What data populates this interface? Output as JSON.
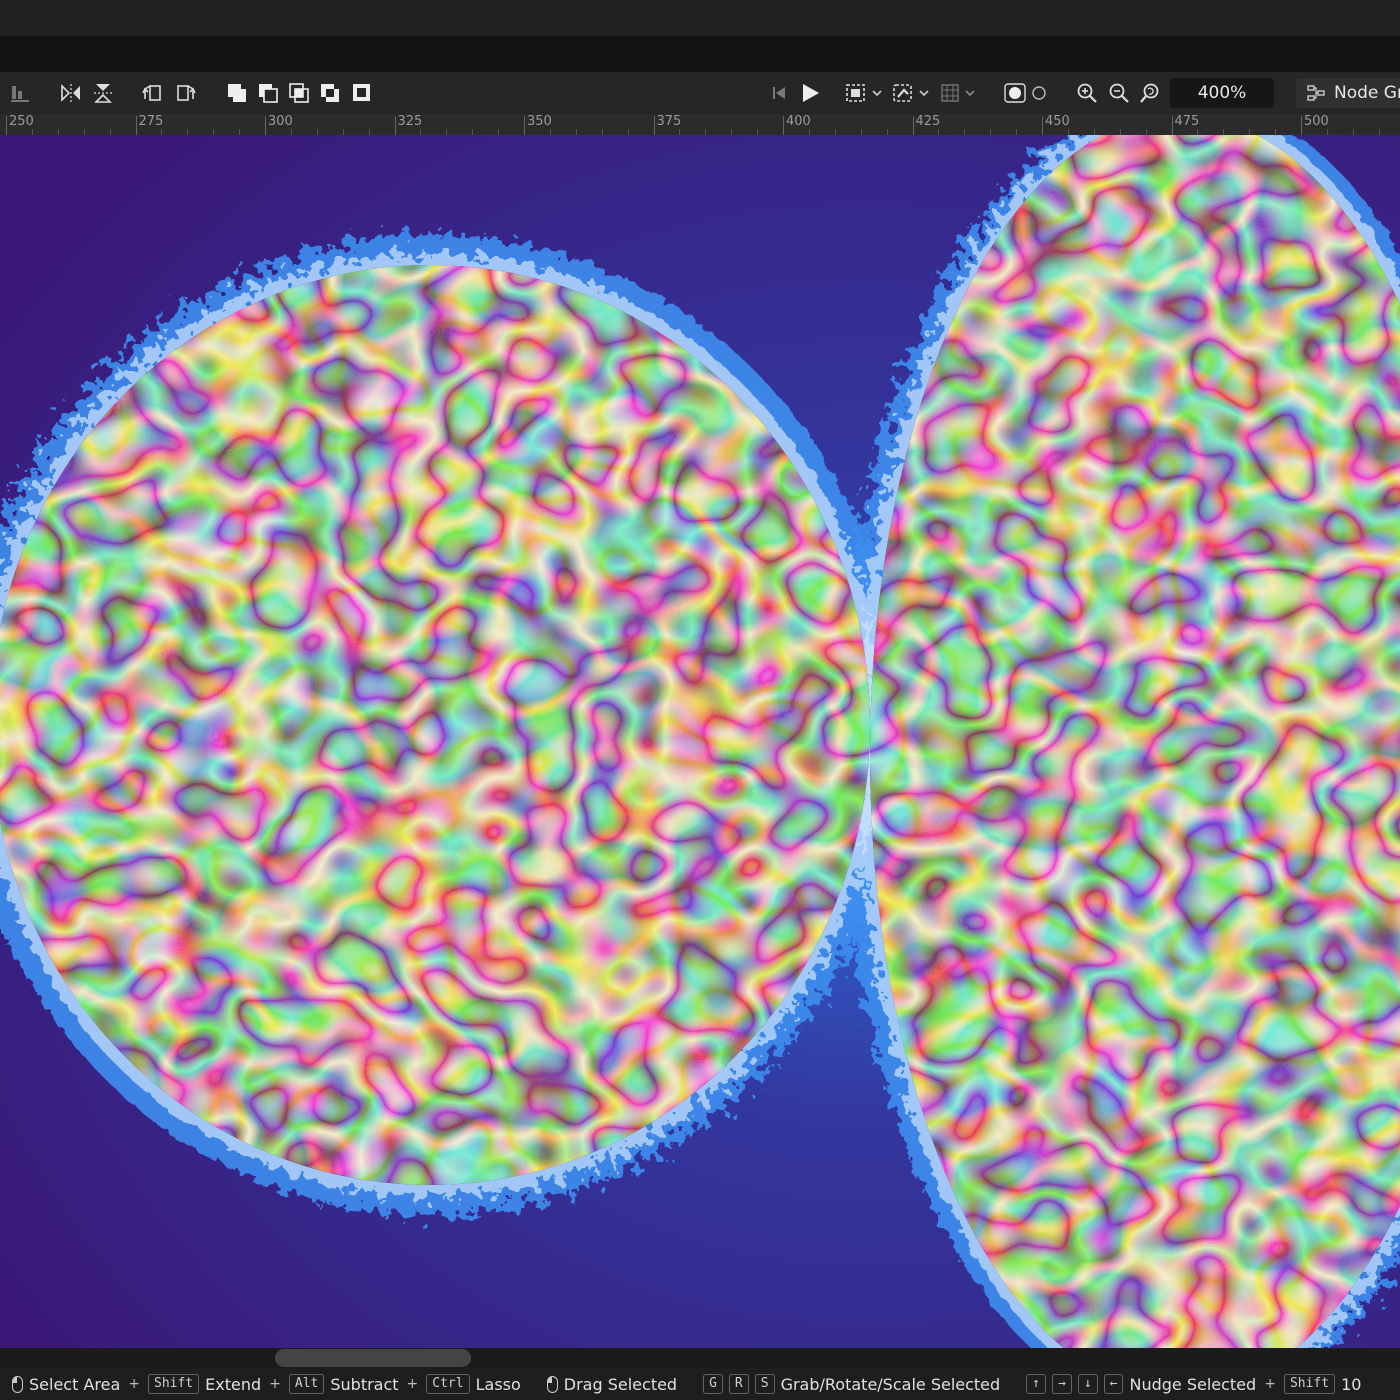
{
  "toolbar": {
    "zoom": "400%",
    "node_graph_label": "Node Gr"
  },
  "ruler": {
    "labels": [
      "250",
      "275",
      "300",
      "325",
      "350",
      "375",
      "400",
      "425",
      "450",
      "475",
      "500"
    ]
  },
  "statusbar": {
    "select_area": "Select Area",
    "key_shift": "Shift",
    "extend": "Extend",
    "key_alt": "Alt",
    "subtract": "Subtract",
    "key_ctrl": "Ctrl",
    "lasso": "Lasso",
    "drag_selected": "Drag Selected",
    "key_g": "G",
    "key_r": "R",
    "key_s": "S",
    "grab_rotate_scale": "Grab/Rotate/Scale Selected",
    "nudge_selected": "Nudge Selected",
    "key_shift2": "Shift",
    "trailing": "10"
  },
  "colors": {
    "background_purple": "#3a1a7a",
    "fractal_blue": "#2a6be0",
    "swirl_dark": "#2a0a14",
    "swirl_cream": "#e8d89a",
    "swirl_teal": "#5fc4b4"
  }
}
